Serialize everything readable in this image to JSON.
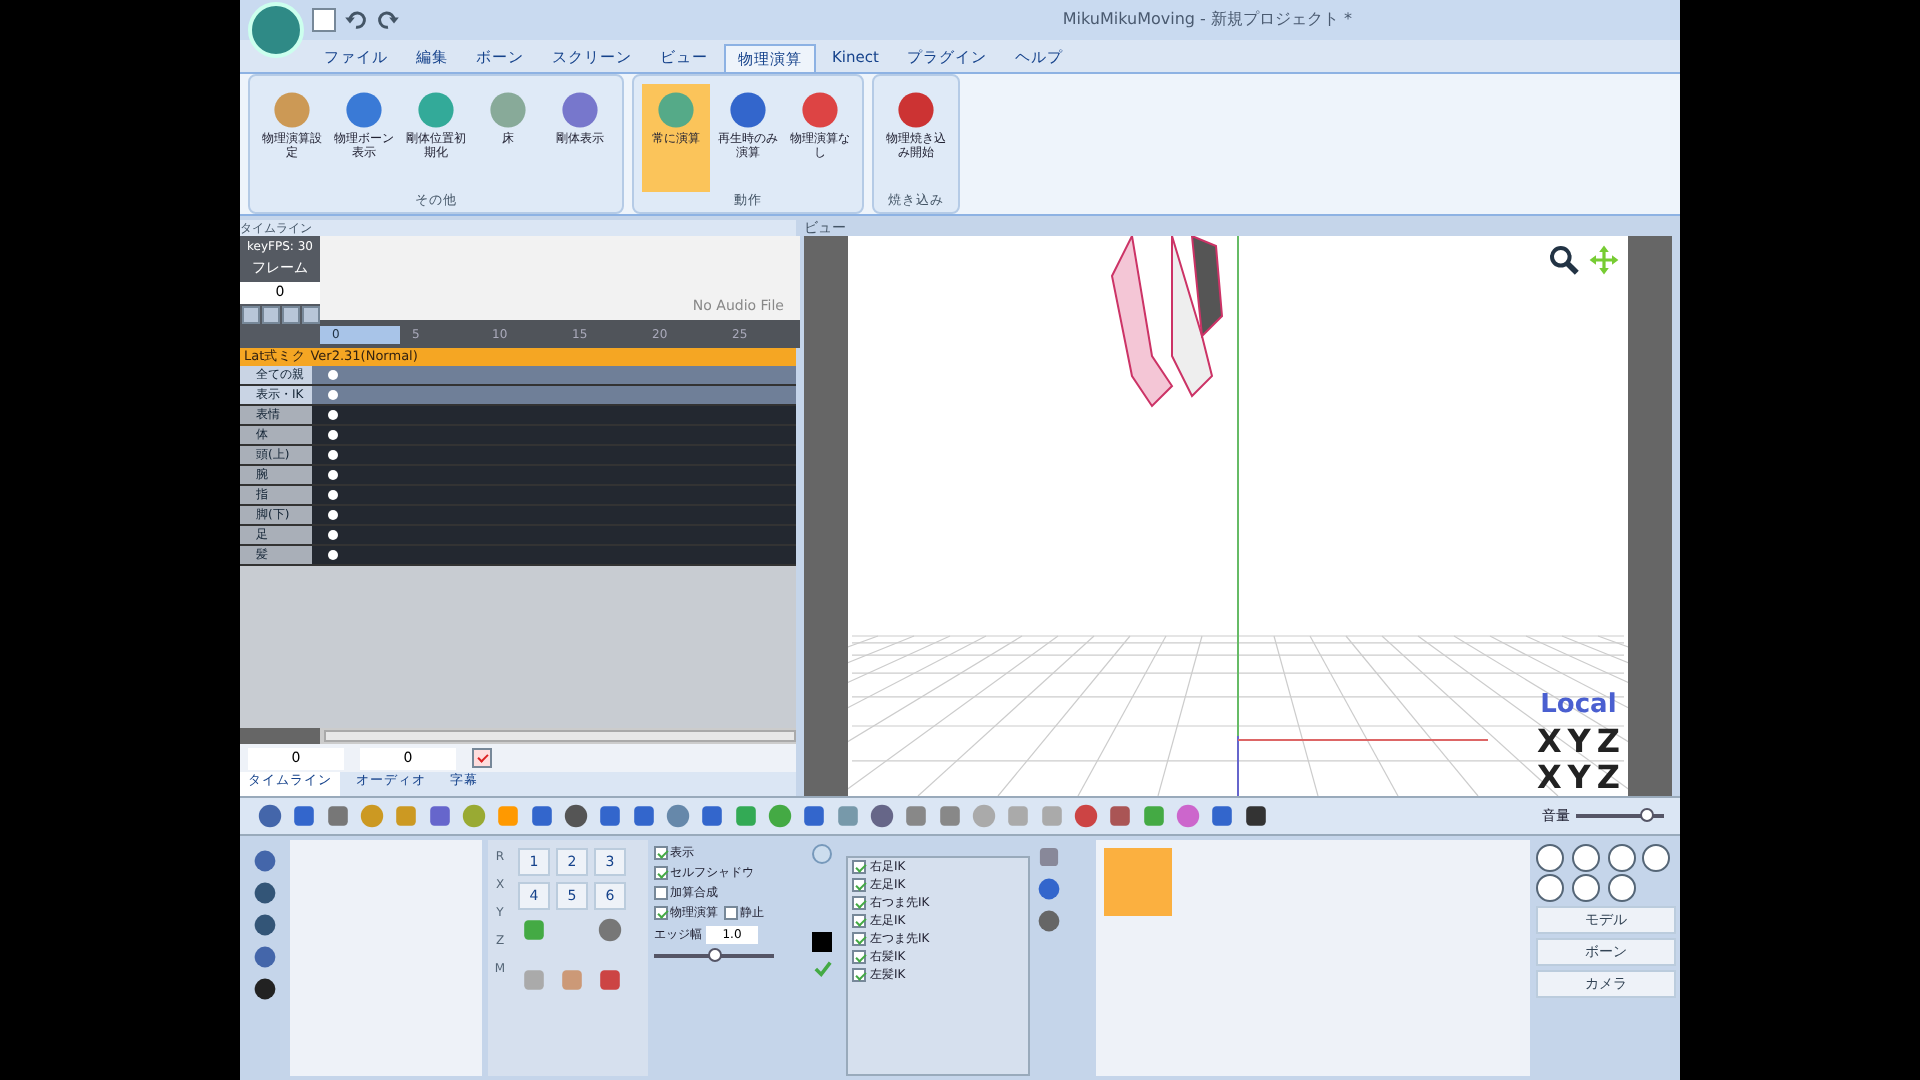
{
  "window": {
    "title": "MikuMikuMoving - 新規プロジェクト *"
  },
  "ribbon_tabs": [
    {
      "label": "ファイル",
      "selected": false
    },
    {
      "label": "編集",
      "selected": false
    },
    {
      "label": "ボーン",
      "selected": false
    },
    {
      "label": "スクリーン",
      "selected": false
    },
    {
      "label": "ビュー",
      "selected": false
    },
    {
      "label": "物理演算",
      "selected": true
    },
    {
      "label": "Kinect",
      "selected": false
    },
    {
      "label": "プラグイン",
      "selected": false
    },
    {
      "label": "ヘルプ",
      "selected": false
    }
  ],
  "ribbon_groups": [
    {
      "label": "その他",
      "buttons": [
        {
          "label": "物理演算設定",
          "selected": false
        },
        {
          "label": "物理ボーン表示",
          "selected": false
        },
        {
          "label": "剛体位置初期化",
          "selected": false
        },
        {
          "label": "床",
          "selected": false
        },
        {
          "label": "剛体表示",
          "selected": false
        }
      ]
    },
    {
      "label": "動作",
      "buttons": [
        {
          "label": "常に演算",
          "selected": true
        },
        {
          "label": "再生時のみ演算",
          "selected": false
        },
        {
          "label": "物理演算なし",
          "selected": false
        }
      ]
    },
    {
      "label": "焼き込み",
      "buttons": [
        {
          "label": "物理焼き込み開始",
          "selected": false
        }
      ]
    }
  ],
  "timeline": {
    "title": "タイムライン",
    "fps": "keyFPS: 30",
    "frame_label": "フレーム",
    "frame_value": "0",
    "audio": "No Audio File",
    "ruler": [
      "0",
      "5",
      "10",
      "15",
      "20",
      "25"
    ],
    "model_row": "Lat式ミク Ver2.31(Normal)",
    "rows": [
      {
        "label": "全ての親",
        "kind": "light"
      },
      {
        "label": "表示・IK",
        "kind": "light"
      },
      {
        "label": "表情",
        "kind": "dark"
      },
      {
        "label": "体",
        "kind": "dark"
      },
      {
        "label": "頭(上)",
        "kind": "dark"
      },
      {
        "label": "腕",
        "kind": "dark"
      },
      {
        "label": "指",
        "kind": "dark"
      },
      {
        "label": "脚(下)",
        "kind": "dark"
      },
      {
        "label": "足",
        "kind": "dark"
      },
      {
        "label": "髪",
        "kind": "dark"
      }
    ],
    "range_start": "0",
    "range_end": "0",
    "range_checked": true,
    "tabs": [
      {
        "label": "タイムライン",
        "selected": true
      },
      {
        "label": "オーディオ",
        "selected": false
      },
      {
        "label": "字幕",
        "selected": false
      }
    ]
  },
  "viewport": {
    "title": "ビュー",
    "mode": "Local",
    "axes_top": [
      "X",
      "Y",
      "Z"
    ],
    "axes_bottom": [
      "X",
      "Y",
      "Z"
    ]
  },
  "toolbar": {
    "volume_label": "音量",
    "volume": {
      "level": 0.8
    }
  },
  "bone_panel": {
    "axis_labels": [
      "R",
      "X",
      "Y",
      "Z",
      "M"
    ],
    "number_buttons": [
      "1",
      "2",
      "3",
      "4",
      "5",
      "6"
    ]
  },
  "model_settings": {
    "checks": [
      {
        "label": "表示",
        "checked": true
      },
      {
        "label": "セルフシャドウ",
        "checked": true
      },
      {
        "label": "加算合成",
        "checked": false
      },
      {
        "label": "物理演算",
        "checked": true
      },
      {
        "label": "静止",
        "checked": false
      }
    ],
    "edge_label": "エッジ幅",
    "edge_value": "1.0",
    "edge": {
      "level": 0.5
    },
    "ik_list": [
      {
        "label": "右足IK",
        "checked": true
      },
      {
        "label": "左足IK",
        "checked": true
      },
      {
        "label": "右つま先IK",
        "checked": true
      },
      {
        "label": "左足IK",
        "checked": true
      },
      {
        "label": "左つま先IK",
        "checked": true
      },
      {
        "label": "右髪IK",
        "checked": true
      },
      {
        "label": "左髪IK",
        "checked": true
      }
    ]
  },
  "mode_buttons": [
    "モデル",
    "ボーン",
    "カメラ"
  ]
}
